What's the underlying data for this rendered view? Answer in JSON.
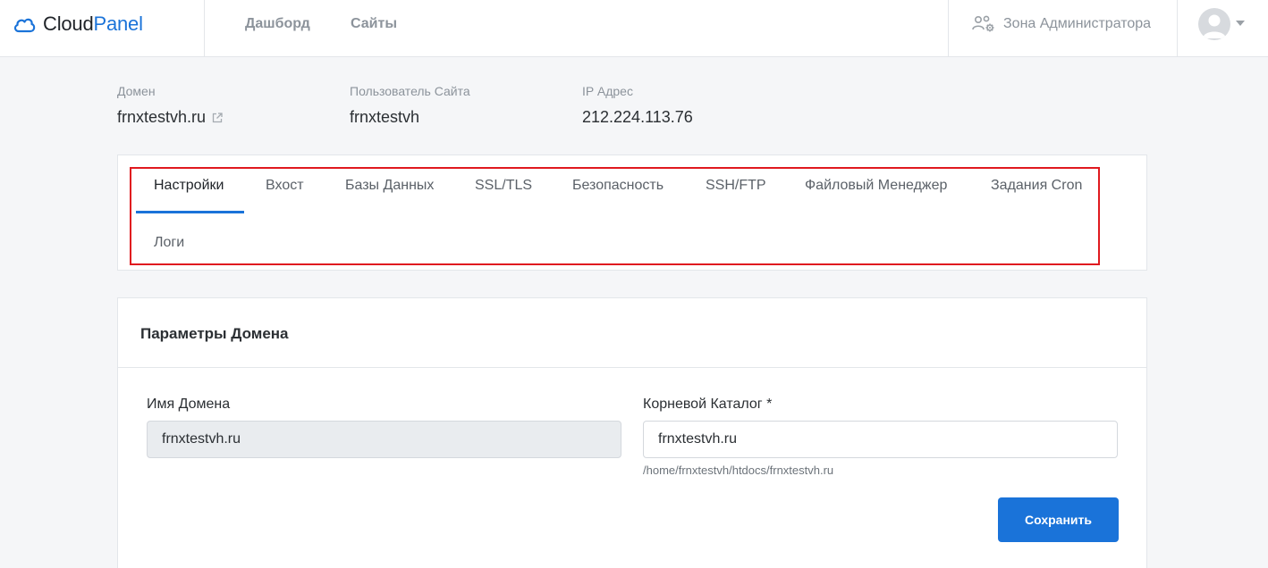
{
  "brand": {
    "name_part1": "Cloud",
    "name_part2": "Panel"
  },
  "nav": {
    "dashboard": "Дашборд",
    "sites": "Сайты"
  },
  "admin": {
    "label": "Зона Администратора"
  },
  "info": {
    "domain_label": "Домен",
    "domain_value": "frnxtestvh.ru",
    "user_label": "Пользователь Сайта",
    "user_value": "frnxtestvh",
    "ip_label": "IP Адрес",
    "ip_value": "212.224.113.76"
  },
  "tabs": {
    "settings": "Настройки",
    "vhost": "Вхост",
    "databases": "Базы Данных",
    "ssl": "SSL/TLS",
    "security": "Безопасность",
    "ssh": "SSH/FTP",
    "files": "Файловый Менеджер",
    "cron": "Задания Cron",
    "logs": "Логи"
  },
  "params": {
    "title": "Параметры Домена",
    "domain_name_label": "Имя Домена",
    "domain_name_value": "frnxtestvh.ru",
    "root_label": "Корневой Каталог *",
    "root_value": "frnxtestvh.ru",
    "root_help": "/home/frnxtestvh/htdocs/frnxtestvh.ru",
    "save_label": "Сохранить"
  },
  "colors": {
    "accent": "#1a73d9",
    "highlight": "#e0191f"
  }
}
